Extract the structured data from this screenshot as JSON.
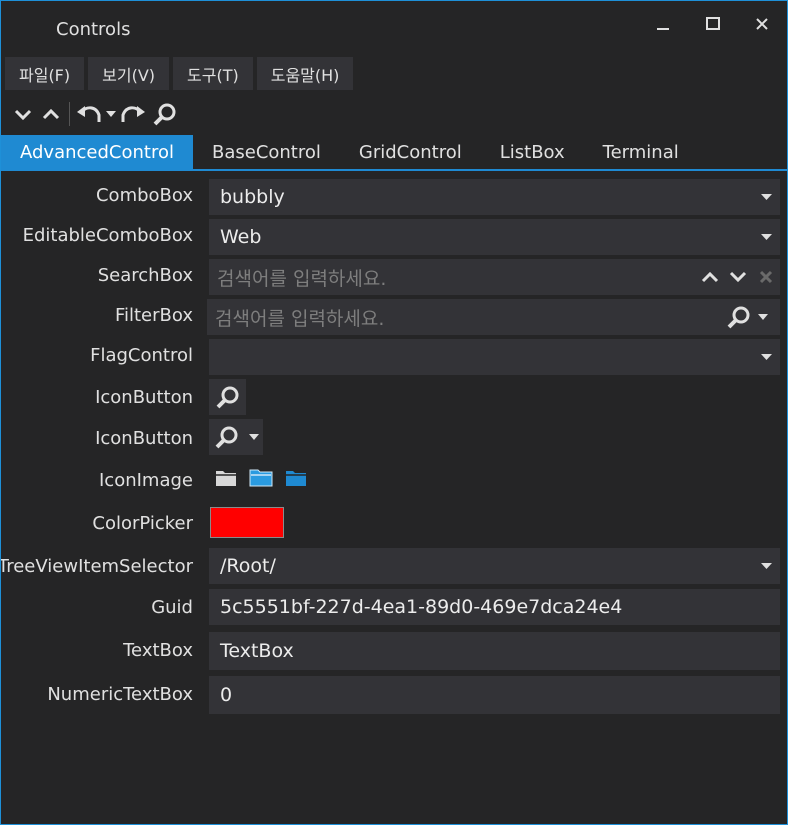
{
  "window": {
    "title": "Controls"
  },
  "menu": {
    "items": [
      {
        "label": "파일(F)"
      },
      {
        "label": "보기(V)"
      },
      {
        "label": "도구(T)"
      },
      {
        "label": "도움말(H)"
      }
    ]
  },
  "toolbar": {
    "buttons": [
      "chevron-down-icon",
      "chevron-up-icon",
      "undo-icon",
      "redo-icon",
      "search-icon"
    ]
  },
  "tabs": [
    {
      "label": "AdvancedControl",
      "active": true
    },
    {
      "label": "BaseControl",
      "active": false
    },
    {
      "label": "GridControl",
      "active": false
    },
    {
      "label": "ListBox",
      "active": false
    },
    {
      "label": "Terminal",
      "active": false
    }
  ],
  "form": {
    "combobox": {
      "label": "ComboBox",
      "value": "bubbly"
    },
    "editable_combobox": {
      "label": "EditableComboBox",
      "value": "Web"
    },
    "searchbox": {
      "label": "SearchBox",
      "placeholder": "검색어를 입력하세요."
    },
    "filterbox": {
      "label": "FilterBox",
      "placeholder": "검색어를 입력하세요."
    },
    "flagcontrol": {
      "label": "FlagControl",
      "value": ""
    },
    "iconbutton1": {
      "label": "IconButton"
    },
    "iconbutton2": {
      "label": "IconButton"
    },
    "iconimage": {
      "label": "IconImage"
    },
    "colorpicker": {
      "label": "ColorPicker",
      "color": "#ff0000"
    },
    "treeview_selector": {
      "label": "TreeViewItemSelector",
      "value": "/Root/"
    },
    "guid": {
      "label": "Guid",
      "value": "5c5551bf-227d-4ea1-89d0-469e7dca24e4"
    },
    "textbox": {
      "label": "TextBox",
      "value": "TextBox"
    },
    "numeric_textbox": {
      "label": "NumericTextBox",
      "value": "0"
    }
  },
  "colors": {
    "accent": "#1f8ad2",
    "background": "#252526",
    "control": "#333337"
  }
}
